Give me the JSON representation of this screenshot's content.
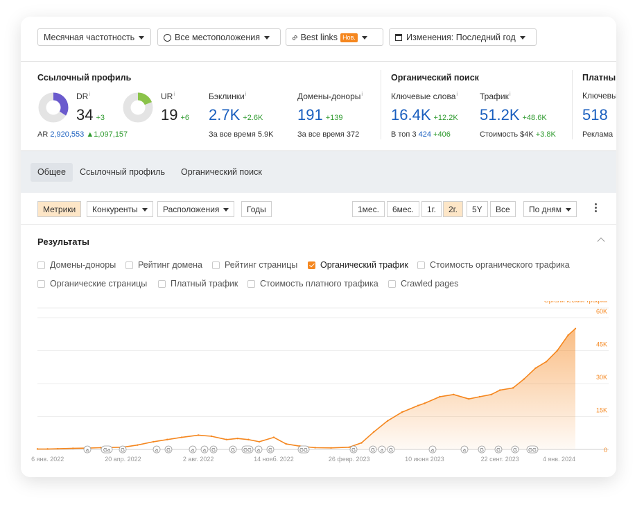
{
  "filters": {
    "frequency": "Месячная частотность",
    "locations": "Все местоположения",
    "best_links": "Best links",
    "best_links_badge": "Нов.",
    "changes": "Изменения: Последний год"
  },
  "link_profile": {
    "title": "Ссылочный профиль",
    "dr_label": "DR",
    "dr_value": "34",
    "dr_delta": "+3",
    "ur_label": "UR",
    "ur_value": "19",
    "ur_delta": "+6",
    "ar_label": "AR",
    "ar_value": "2,920,553",
    "ar_delta": "▲1,097,157",
    "backlinks_label": "Бэклинки",
    "backlinks_value": "2.7K",
    "backlinks_delta": "+2.6K",
    "backlinks_all_time": "За все время",
    "backlinks_all_time_value": "5.9K",
    "domains_label": "Домены-доноры",
    "domains_value": "191",
    "domains_delta": "+139",
    "domains_all_time": "За все время",
    "domains_all_time_value": "372"
  },
  "organic": {
    "title": "Органический поиск",
    "keywords_label": "Ключевые слова",
    "keywords_value": "16.4K",
    "keywords_delta": "+12.2K",
    "top3_label": "В топ 3",
    "top3_value": "424",
    "top3_delta": "+406",
    "traffic_label": "Трафик",
    "traffic_value": "51.2K",
    "traffic_delta": "+48.6K",
    "cost_label": "Стоимость",
    "cost_value": "$4K",
    "cost_delta": "+3.8K"
  },
  "paid": {
    "title": "Платны",
    "keywords_label": "Ключевы",
    "keywords_value": "518",
    "ads_label": "Реклама"
  },
  "tabs": [
    "Общее",
    "Ссылочный профиль",
    "Органический поиск"
  ],
  "toolbar": {
    "metrics": "Метрики",
    "competitors": "Конкуренты",
    "locations": "Расположения",
    "years": "Годы",
    "ranges": [
      "1мес.",
      "6мес.",
      "1г.",
      "2г.",
      "5Y",
      "Все"
    ],
    "group_by": "По дням"
  },
  "results": {
    "title": "Результаты",
    "checkboxes": [
      {
        "label": "Домены-доноры",
        "checked": false
      },
      {
        "label": "Рейтинг домена",
        "checked": false
      },
      {
        "label": "Рейтинг страницы",
        "checked": false
      },
      {
        "label": "Органический трафик",
        "checked": true
      },
      {
        "label": "Стоимость органического трафика",
        "checked": false
      },
      {
        "label": "Органические страницы",
        "checked": false
      },
      {
        "label": "Платный трафик",
        "checked": false
      },
      {
        "label": "Стоимость платного трафика",
        "checked": false
      },
      {
        "label": "Crawled pages",
        "checked": false
      }
    ]
  },
  "colors": {
    "accent": "#f5871f",
    "blue": "#1a5fbf",
    "green": "#2e9a2e",
    "dr_ring": "#6a5acd",
    "ur_ring": "#8bc34a"
  },
  "chart_data": {
    "type": "area",
    "series": [
      {
        "name": "Органический трафик",
        "x": [
          "2021-12-23",
          "2022-01-06",
          "2022-01-20",
          "2022-02-10",
          "2022-03-01",
          "2022-03-20",
          "2022-04-20",
          "2022-05-10",
          "2022-06-01",
          "2022-06-20",
          "2022-07-10",
          "2022-08-02",
          "2022-08-20",
          "2022-09-10",
          "2022-09-25",
          "2022-10-10",
          "2022-10-25",
          "2022-11-14",
          "2022-12-01",
          "2022-12-20",
          "2023-01-10",
          "2023-02-01",
          "2023-02-26",
          "2023-03-15",
          "2023-04-01",
          "2023-04-20",
          "2023-05-10",
          "2023-06-01",
          "2023-06-10",
          "2023-07-01",
          "2023-07-20",
          "2023-08-10",
          "2023-08-25",
          "2023-09-10",
          "2023-09-22",
          "2023-10-10",
          "2023-10-25",
          "2023-11-10",
          "2023-11-25",
          "2023-12-10",
          "2023-12-25",
          "2024-01-04"
        ],
        "values": [
          200,
          200,
          300,
          500,
          600,
          800,
          1000,
          2000,
          3500,
          4500,
          5500,
          6500,
          6000,
          4500,
          5000,
          4500,
          3500,
          5500,
          2500,
          1500,
          800,
          700,
          1000,
          3000,
          8000,
          13000,
          17000,
          20000,
          21000,
          24000,
          25000,
          23000,
          24000,
          25000,
          27000,
          28000,
          32000,
          37000,
          40000,
          45000,
          52000,
          55000
        ]
      }
    ],
    "x_tick_labels": [
      "6 янв. 2022",
      "20 апр. 2022",
      "2 авг. 2022",
      "14 нояб. 2022",
      "26 февр. 2023",
      "10 июня 2023",
      "22 сент. 2023",
      "4 янв. 2024"
    ],
    "y_tick_labels": [
      "0",
      "15K",
      "30K",
      "45K",
      "60K"
    ],
    "ylim": [
      0,
      60000
    ],
    "annotation_labels": [
      "a",
      "Ga",
      "G",
      "a",
      "G",
      "a",
      "a",
      "G",
      "G",
      "GG",
      "a",
      "G",
      "GG",
      "G",
      "G",
      "a",
      "G",
      "a",
      "a",
      "G",
      "G",
      "G",
      "GG"
    ],
    "grid": true,
    "legend": "top-right",
    "y_axis_side": "right"
  }
}
